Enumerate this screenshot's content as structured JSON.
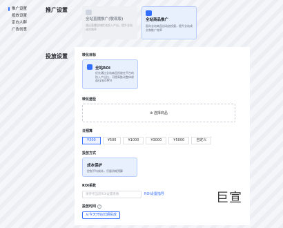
{
  "sidebar": {
    "items": [
      {
        "label": "推广设置"
      },
      {
        "label": "投放设置"
      },
      {
        "label": "定向人群"
      },
      {
        "label": "广告创意"
      }
    ]
  },
  "promotion": {
    "title": "推广设置",
    "cards": [
      {
        "title": "全站直播推广(敬现版)",
        "desc": "通过直播全域优化投入产出，提升全站成交效率"
      },
      {
        "title": "全站商品推广",
        "desc": "面向全站商品自动追投量，提升全站成交和推广效率"
      }
    ]
  },
  "delivery": {
    "title": "投放设置",
    "goal_label": "转化目标",
    "goal_card": {
      "title": "全站ROI",
      "desc": "优先通过全站商品投放在平台的投入产出比，可提高推动整体收益(全站GMV)"
    },
    "path_label": "转化途径",
    "select_product": "⊕ 选择商品",
    "budget_label": "日预算",
    "budget_options": [
      "¥300",
      "¥500",
      "¥1000",
      "¥3000",
      "¥5000",
      "自定义"
    ],
    "method_label": "投放方式",
    "method_card": {
      "title": "成本保护",
      "desc": "控制平均成本，尽量消耗预算"
    },
    "roi_label": "ROI系数",
    "roi_placeholder": "请参考当前ROI设置系数",
    "roi_link": "ROI设置指导",
    "time_label": "投放时间",
    "time_button": "从今天开始长期投放"
  },
  "watermark_text": "巨宣",
  "colors": {
    "accent": "#3370ff",
    "selected_bg": "#e8f0fe"
  }
}
